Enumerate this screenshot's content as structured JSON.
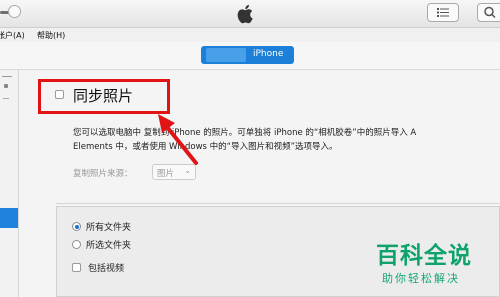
{
  "app": {
    "logo": "apple-logo"
  },
  "toolbar": {
    "list_icon": "list-icon",
    "search_icon": "search-icon"
  },
  "menu": {
    "items": [
      "帐户(A)",
      "帮助(H)"
    ]
  },
  "device": {
    "name": "iPhone"
  },
  "sync_photos": {
    "label": "同步照片",
    "checked": false
  },
  "description": {
    "line1": "您可以选取电脑中  复制到 iPhone 的照片。可单独将 iPhone 的“相机胶卷”中的照片导入 A",
    "line2": "Elements 中，或者使用 Windows 中的“导入图片和视频”选项导入。"
  },
  "source": {
    "label": "复制照片来源：",
    "selected": "图片"
  },
  "options": {
    "all_folders": "所有文件夹",
    "selected_folders": "所选文件夹",
    "include_videos": "包括视频",
    "selected_option": "all_folders"
  },
  "watermark": {
    "title": "百科全说",
    "subtitle": "助你轻松解决"
  },
  "colors": {
    "accent_blue": "#1c7fd8",
    "highlight_red": "#e01414",
    "watermark_green": "#0fa36b"
  }
}
